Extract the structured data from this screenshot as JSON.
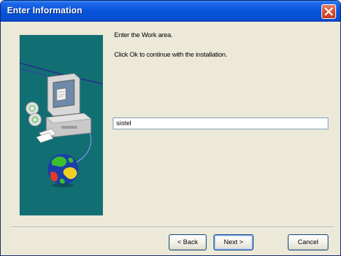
{
  "window": {
    "title": "Enter Information"
  },
  "content": {
    "prompt_line1": "Enter the Work area.",
    "prompt_line2": "Click Ok to continue with the installation."
  },
  "work_area_input": {
    "value": "sistel"
  },
  "buttons": {
    "back_label": "< Back",
    "next_label": "Next >",
    "cancel_label": "Cancel"
  },
  "colors": {
    "titlebar": "#0856dd",
    "dialog_background": "#ece9d8",
    "banner_background": "#116f74"
  },
  "icons": {
    "close": "close-icon",
    "banner": "computer-globe-illustration"
  }
}
